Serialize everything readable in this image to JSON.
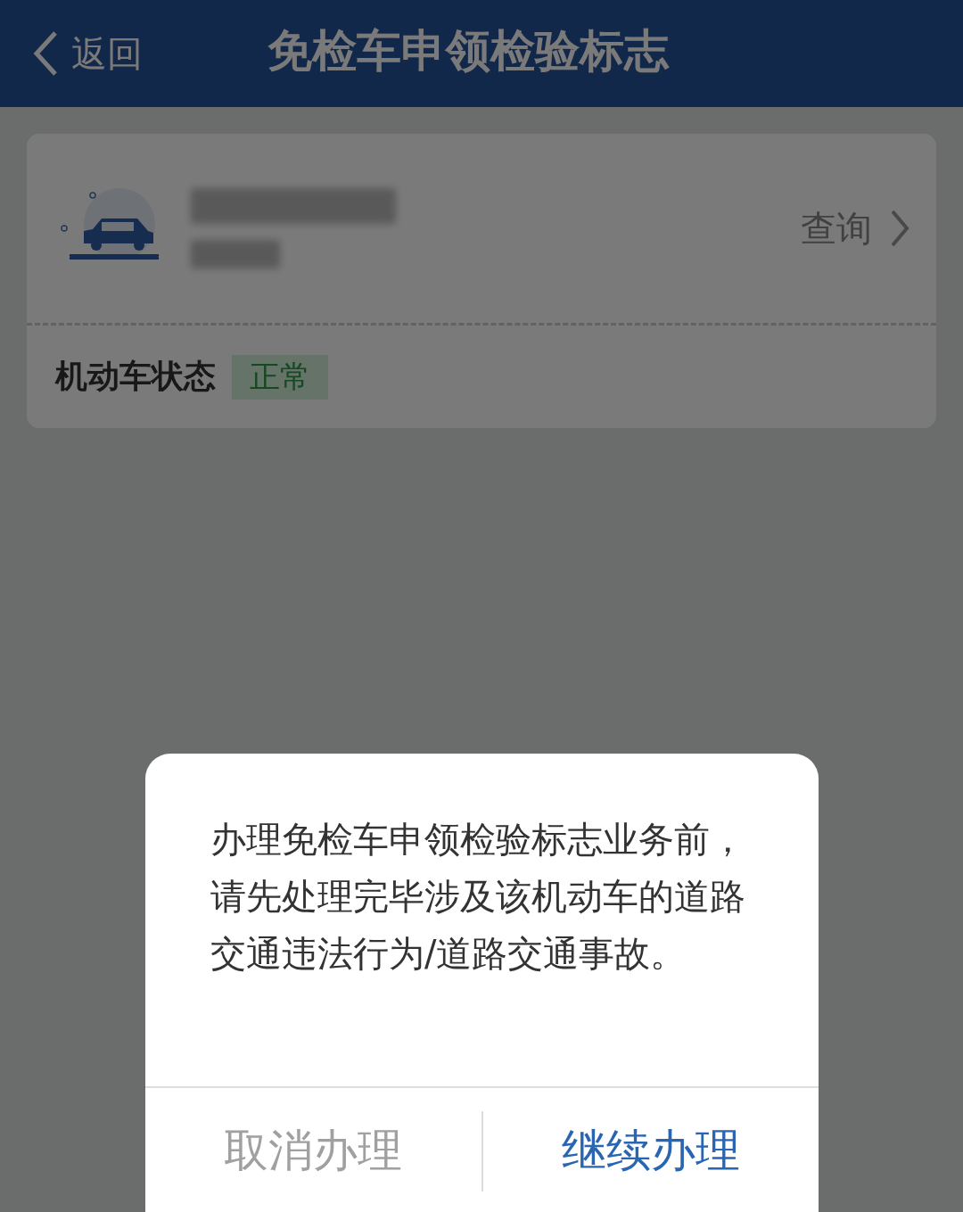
{
  "header": {
    "back_label": "返回",
    "title": "免检车申领检验标志"
  },
  "vehicle": {
    "query_label": "查询",
    "status_label": "机动车状态",
    "status": "正常"
  },
  "dialog": {
    "message": "办理免检车申领检验标志业务前，请先处理完毕涉及该机动车的道路交通违法行为/道路交通事故。",
    "buttons": [
      {
        "label": "取消办理",
        "kind": "cancel"
      },
      {
        "label": "继续办理",
        "kind": "confirm"
      }
    ]
  }
}
